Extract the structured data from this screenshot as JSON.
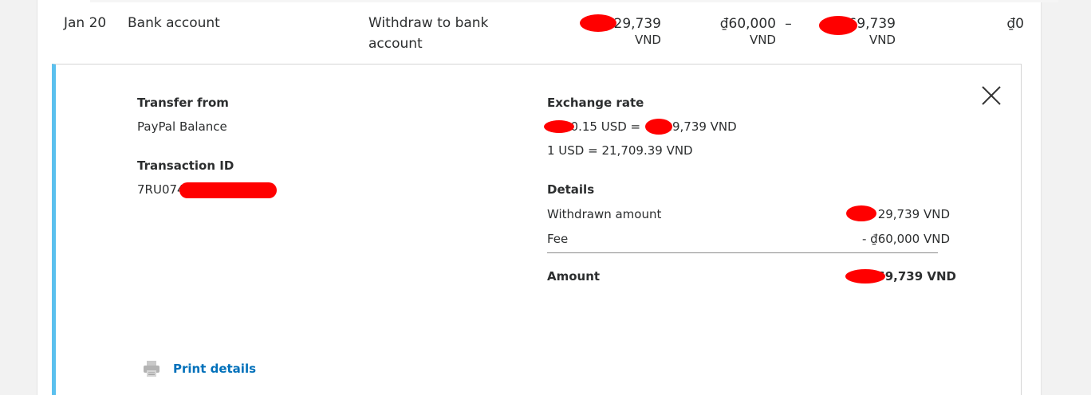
{
  "transaction_row": {
    "date": "Jan 20",
    "name": "Bank account",
    "type_line1": "Withdraw to bank",
    "type_line2": "account",
    "gross": "29,739",
    "gross_currency": "VND",
    "fee": "₫60,000",
    "fee_currency": "VND",
    "net_prefix": "–",
    "net": "69,739",
    "net_currency": "VND",
    "balance": "₫0"
  },
  "details": {
    "transfer_from_label": "Transfer from",
    "transfer_from_value": "PayPal Balance",
    "transaction_id_label": "Transaction ID",
    "transaction_id_value": "7RU074",
    "exchange_rate_label": "Exchange rate",
    "exchange_line1_part1": "10.15 USD = ",
    "exchange_line1_part2": "929,739 VND",
    "exchange_line2": "1 USD = 21,709.39 VND",
    "details_label": "Details",
    "withdrawn_label": "Withdrawn amount",
    "withdrawn_value": "29,739 VND",
    "fee_label": "Fee",
    "fee_value": "- ₫60,000 VND",
    "amount_label": "Amount",
    "amount_value": "69,739 VND",
    "print_label": "Print details"
  },
  "colors": {
    "accent_bar": "#5bc0ee",
    "link": "#0070ba",
    "redaction": "#ff0000"
  },
  "icons": {
    "close": "close-icon",
    "print": "printer-icon"
  }
}
